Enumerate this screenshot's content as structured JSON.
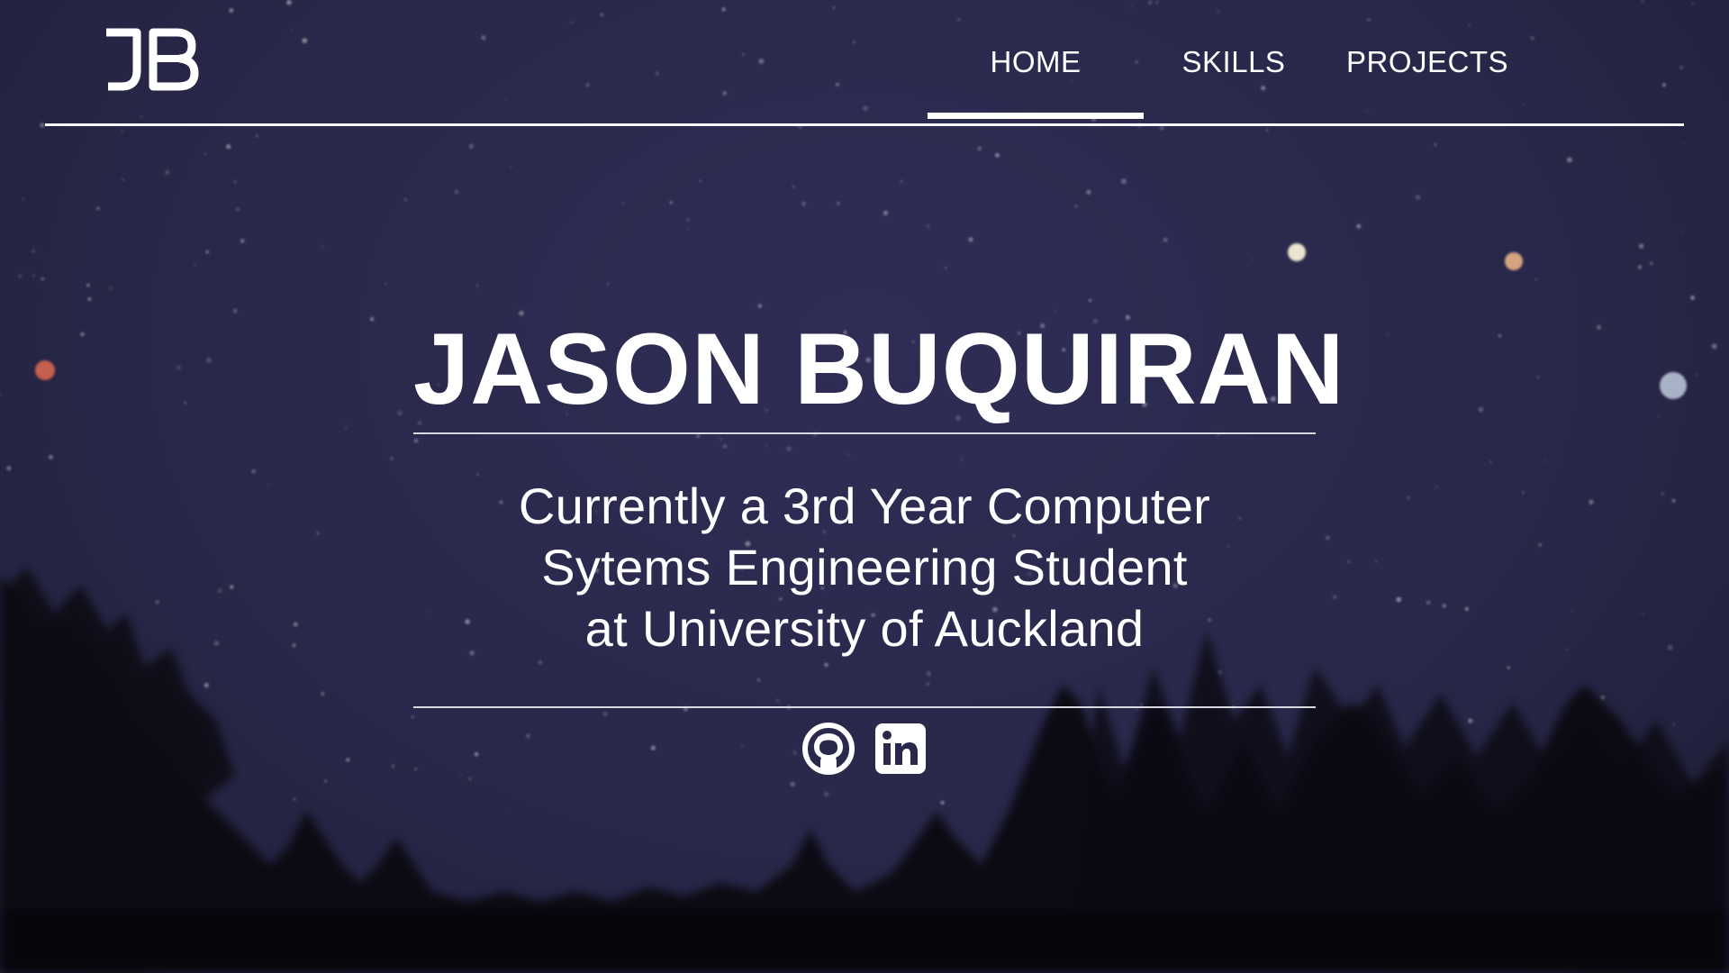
{
  "header": {
    "logo_alt": "JB",
    "nav": [
      {
        "label": "HOME",
        "active": true
      },
      {
        "label": "SKILLS",
        "active": false
      },
      {
        "label": "PROJECTS",
        "active": false
      }
    ]
  },
  "hero": {
    "name": "JASON BUQUIRAN",
    "tagline_lines": [
      "Currently a 3rd Year Computer",
      "Sytems Engineering Student",
      "at University of Auckland"
    ],
    "socials": [
      {
        "icon": "github-icon"
      },
      {
        "icon": "linkedin-icon"
      }
    ]
  },
  "colors": {
    "sky": "#29284a",
    "text": "#ffffff",
    "trees": "#0b0a12"
  }
}
